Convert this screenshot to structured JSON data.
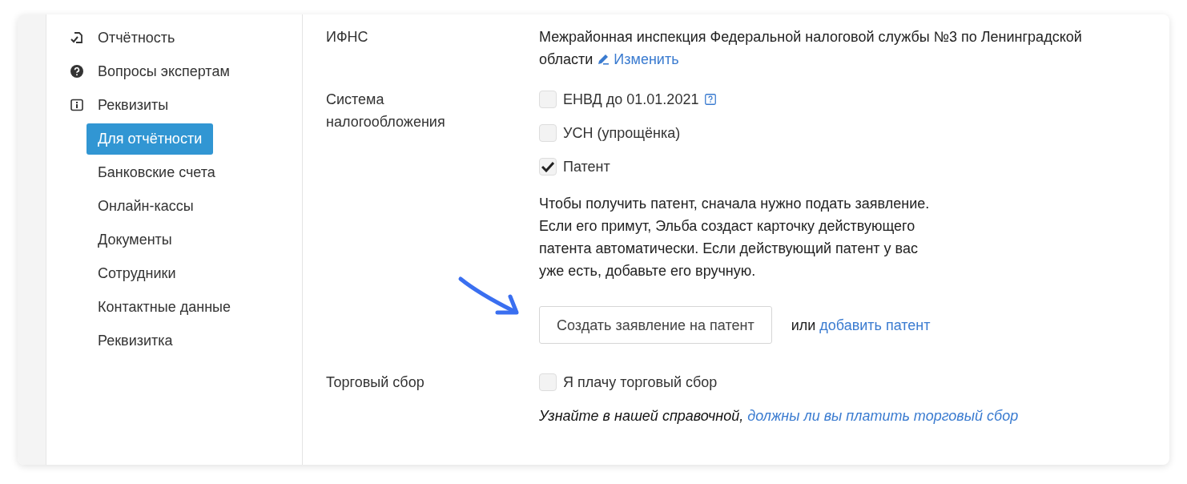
{
  "sidebar": {
    "items": [
      {
        "label": "Отчётность",
        "selected": false
      },
      {
        "label": "Вопросы экспертам",
        "selected": false
      },
      {
        "label": "Реквизиты",
        "selected": false,
        "children": [
          {
            "label": "Для отчётности",
            "selected": true
          },
          {
            "label": "Банковские счета",
            "selected": false
          },
          {
            "label": "Онлайн-кассы",
            "selected": false
          },
          {
            "label": "Документы",
            "selected": false
          },
          {
            "label": "Сотрудники",
            "selected": false
          },
          {
            "label": "Контактные данные",
            "selected": false
          },
          {
            "label": "Реквизитка",
            "selected": false
          }
        ]
      }
    ]
  },
  "form": {
    "rows": [
      {
        "kind": "text",
        "label": "ИФНС",
        "value": "Межрайонная инспекция Федеральной налоговой службы №3 по Ленинградской области",
        "link": "Изменить"
      },
      {
        "kind": "options",
        "label": "Система налогообложения",
        "options": [
          {
            "label": "ЕНВД до 01.01.2021",
            "checked": false,
            "help": true
          },
          {
            "label": "УСН (упрощёнка)",
            "checked": false,
            "help": false
          },
          {
            "label": "Патент",
            "checked": true,
            "help": false
          }
        ],
        "note": "Чтобы получить патент, сначала нужно подать заявление.\nЕсли его примут, Эльба создаст карточку действующего\nпатента автоматически. Если действующий патент у вас\nуже есть, добавьте его вручную.",
        "button": "Создать заявление на патент",
        "or_text": "или",
        "or_link": "добавить патент"
      },
      {
        "kind": "options",
        "label": "Торговый сбор",
        "options": [
          {
            "label": "Я плачу торговый сбор",
            "checked": false,
            "help": false
          }
        ],
        "hint": "Узнайте в нашей справочной,",
        "hint_link": "должны ли вы платить торговый сбор"
      }
    ]
  }
}
